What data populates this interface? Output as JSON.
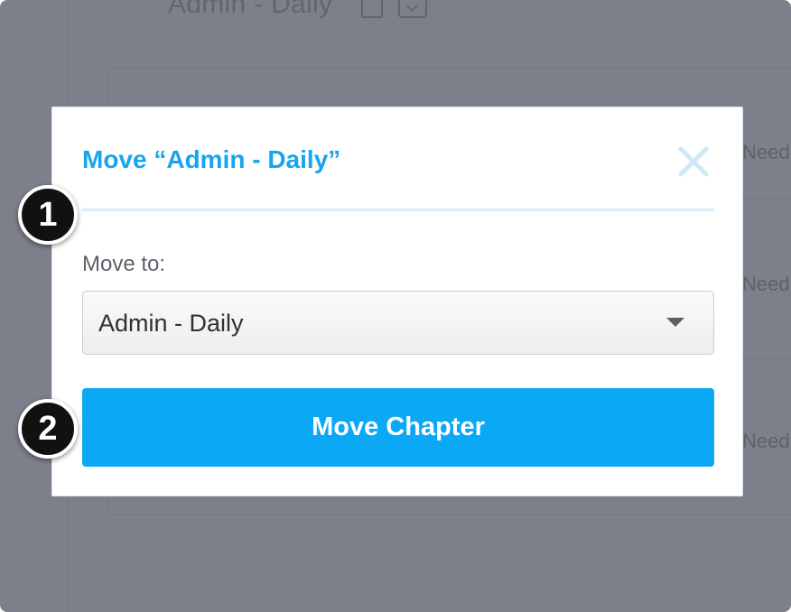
{
  "background": {
    "page_title": "Admin - Daily",
    "row_text": [
      "Need",
      "Need",
      "Need"
    ]
  },
  "modal": {
    "title": "Move “Admin - Daily”",
    "close_icon": "close-icon",
    "field_label": "Move to:",
    "select_value": "Admin - Daily",
    "submit_label": "Move Chapter"
  },
  "annotations": {
    "step_1": "1",
    "step_2": "2"
  },
  "colors": {
    "accent": "#16a5ee",
    "button": "#0aa8f5",
    "overlay": "#7d808a"
  }
}
